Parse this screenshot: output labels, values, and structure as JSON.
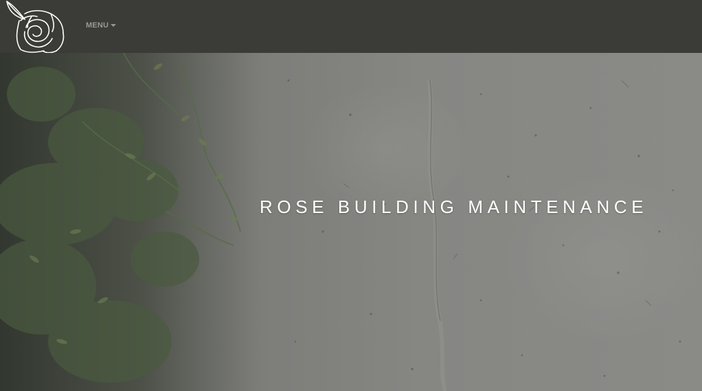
{
  "header": {
    "logo_icon": "rose-icon",
    "menu_label": "MENU",
    "menu_icon": "caret-down-icon",
    "background_color": "#3b3b37",
    "menu_color": "#9a9a92"
  },
  "hero": {
    "title": "ROSE BUILDING MAINTENANCE",
    "title_color": "#ffffff",
    "background_description_icon": "concrete-wall-with-foliage"
  }
}
